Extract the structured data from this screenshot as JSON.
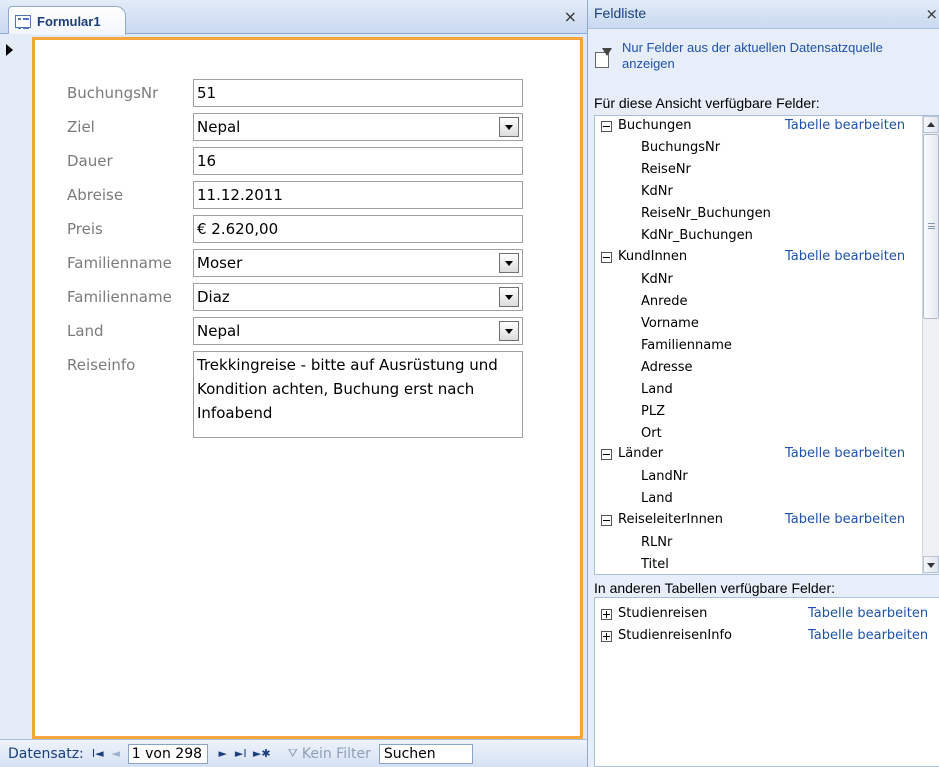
{
  "form": {
    "tab_title": "Formular1",
    "close_glyph": "×",
    "fields": [
      {
        "label": "BuchungsNr",
        "value": "51",
        "type": "text"
      },
      {
        "label": "Ziel",
        "value": "Nepal",
        "type": "combo"
      },
      {
        "label": "Dauer",
        "value": "16",
        "type": "text"
      },
      {
        "label": "Abreise",
        "value": "11.12.2011",
        "type": "text"
      },
      {
        "label": "Preis",
        "value": "€ 2.620,00",
        "type": "text"
      },
      {
        "label": "Familienname",
        "value": "Moser",
        "type": "combo"
      },
      {
        "label": "Familienname",
        "value": "Diaz",
        "type": "combo"
      },
      {
        "label": "Land",
        "value": "Nepal",
        "type": "combo"
      },
      {
        "label": "Reiseinfo",
        "value": "Trekkingreise - bitte auf Ausrüstung und Kondition achten, Buchung erst nach Infoabend",
        "type": "memo"
      }
    ]
  },
  "navigation": {
    "label": "Datensatz:",
    "record_position": "1 von 298",
    "filter_label": "Kein Filter",
    "search_placeholder": "Suchen",
    "first_glyph": "I◄",
    "prev_glyph": "◄",
    "next_glyph": "►",
    "last_glyph": "►I",
    "new_glyph": "►✱"
  },
  "field_list": {
    "title": "Feldliste",
    "close_glyph": "×",
    "only_current_link": "Nur Felder aus der aktuellen Datensatzquelle anzeigen",
    "available_label": "Für diese Ansicht verfügbare Felder:",
    "other_tables_label": "In anderen Tabellen verfügbare Felder:",
    "edit_table_label": "Tabelle bearbeiten",
    "tables": [
      {
        "name": "Buchungen",
        "fields": [
          "BuchungsNr",
          "ReiseNr",
          "KdNr",
          "ReiseNr_Buchungen",
          "KdNr_Buchungen"
        ]
      },
      {
        "name": "KundInnen",
        "fields": [
          "KdNr",
          "Anrede",
          "Vorname",
          "Familienname",
          "Adresse",
          "Land",
          "PLZ",
          "Ort"
        ]
      },
      {
        "name": "Länder",
        "fields": [
          "LandNr",
          "Land"
        ]
      },
      {
        "name": "ReiseleiterInnen",
        "fields": [
          "RLNr",
          "Titel"
        ]
      }
    ],
    "other_tables": [
      "Studienreisen",
      "StudienreisenInfo"
    ]
  }
}
